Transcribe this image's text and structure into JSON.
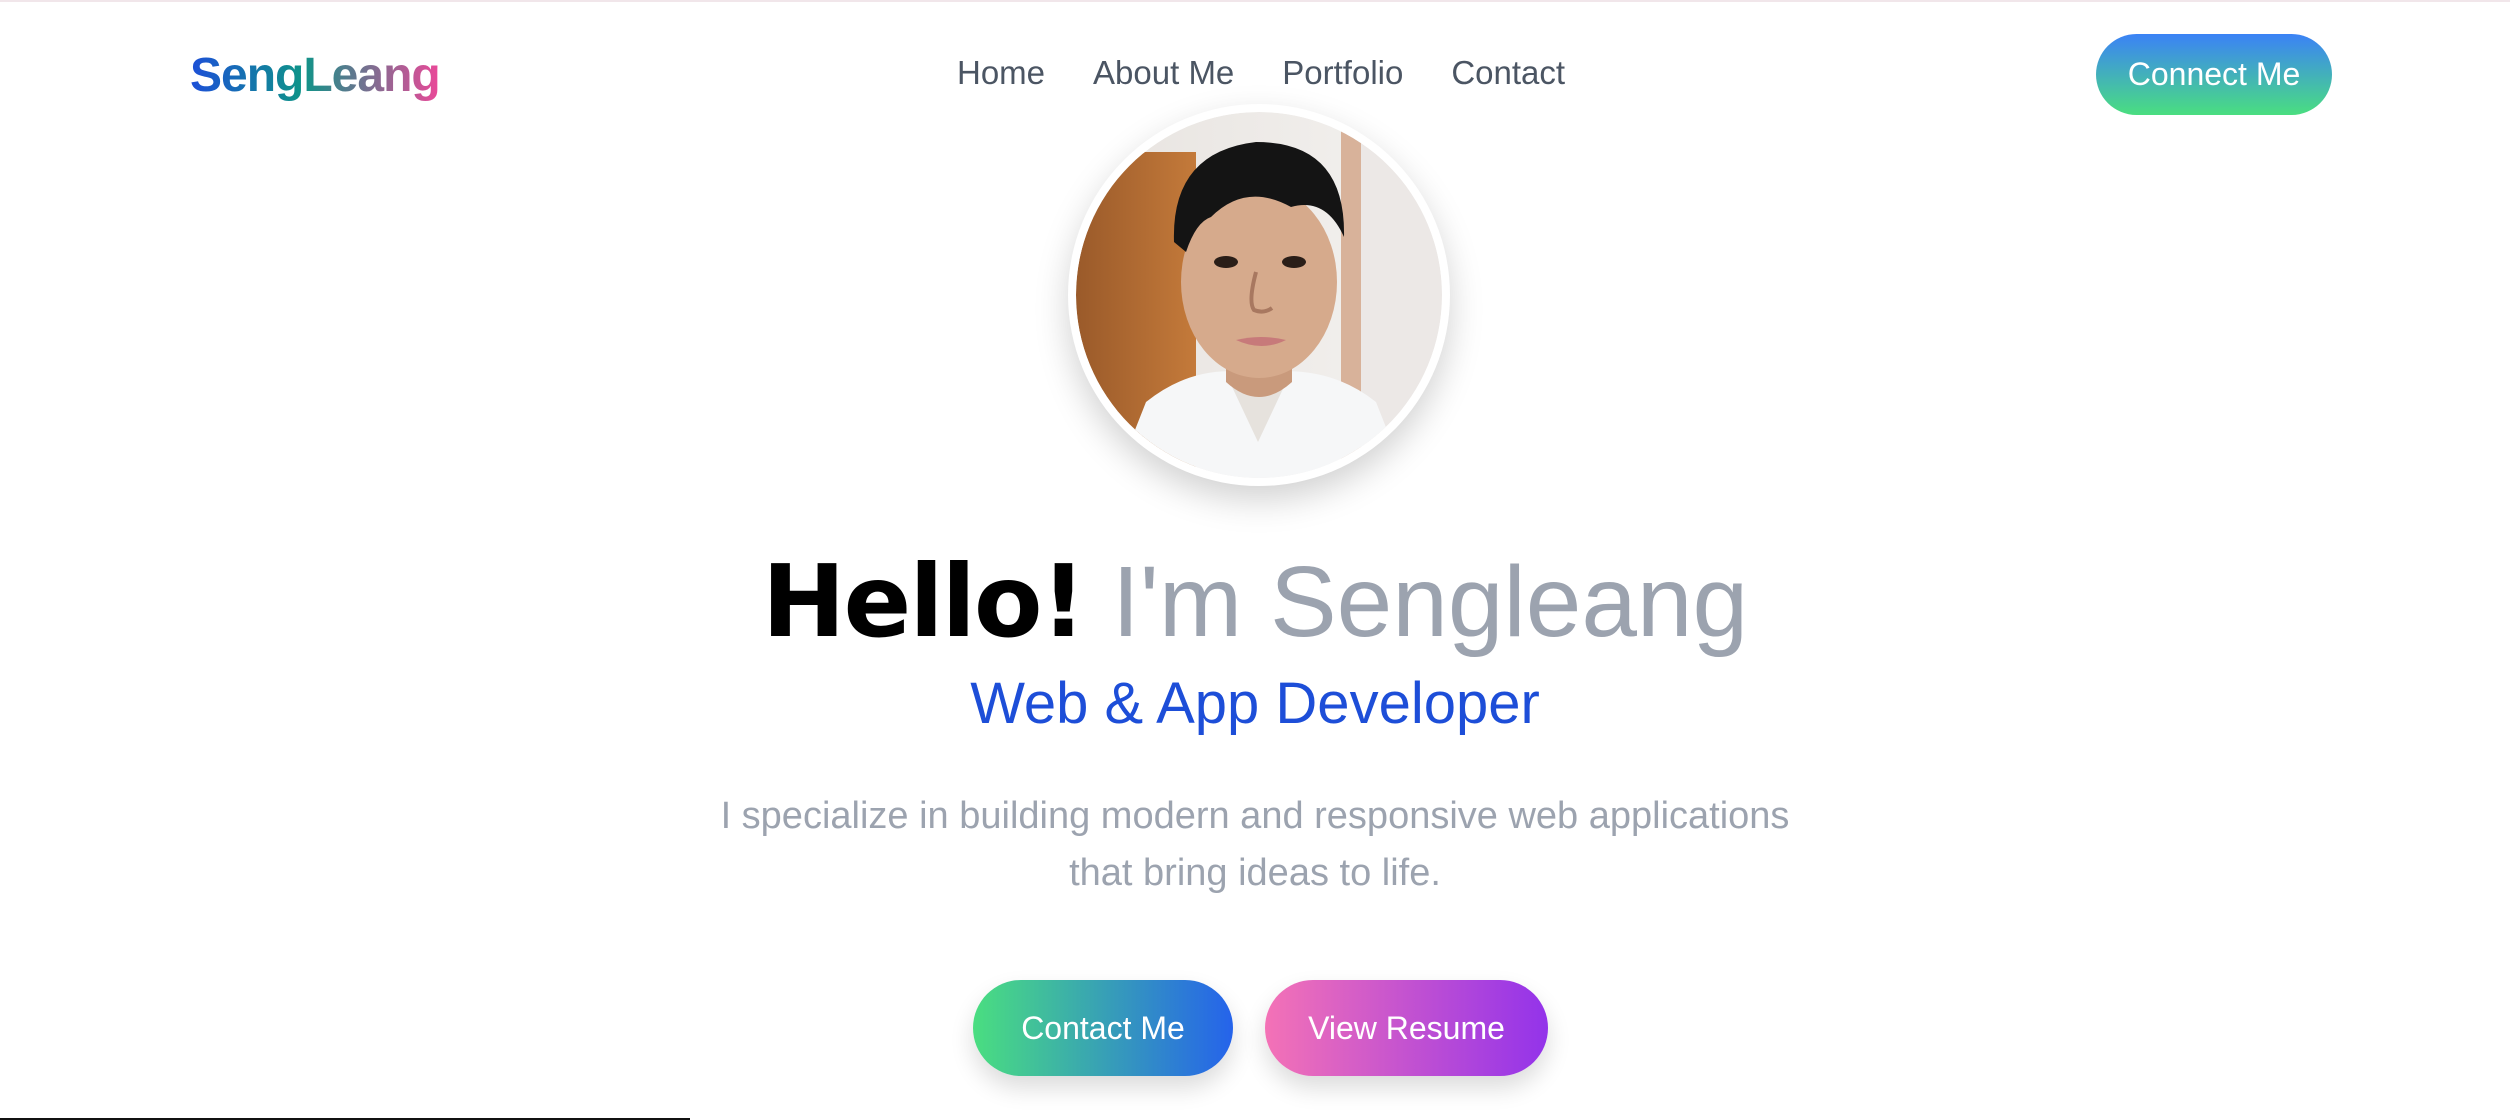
{
  "header": {
    "logo": "SengLeang",
    "nav": [
      {
        "label": "Home"
      },
      {
        "label": "About Me"
      },
      {
        "label": "Portfolio"
      },
      {
        "label": "Contact"
      }
    ],
    "cta_label": "Connect Me"
  },
  "hero": {
    "greeting": "Hello!",
    "intro": "I'm Sengleang",
    "role": "Web & App Developer",
    "description": "I specialize in building modern and responsive web applications that bring ideas to life.",
    "primary_button": "Contact Me",
    "secondary_button": "View Resume",
    "avatar_icon": "profile-photo"
  },
  "colors": {
    "accent_blue": "#1d4ed8",
    "muted_text": "#9ca3af",
    "nav_text": "#4b5563",
    "green": "#4ade80",
    "pink": "#f472b6",
    "purple": "#9333ea"
  }
}
